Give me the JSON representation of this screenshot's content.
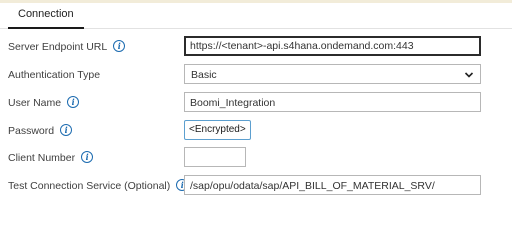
{
  "tabs": {
    "active": "Connection"
  },
  "form": {
    "server_endpoint": {
      "label": "Server Endpoint URL",
      "value": "https://<tenant>-api.s4hana.ondemand.com:443"
    },
    "authentication_type": {
      "label": "Authentication Type",
      "value": "Basic"
    },
    "user_name": {
      "label": "User Name",
      "value": "Boomi_Integration"
    },
    "password": {
      "label": "Password",
      "button": "<Encrypted>"
    },
    "client_number": {
      "label": "Client Number",
      "value": ""
    },
    "test_service": {
      "label": "Test Connection Service (Optional)",
      "value": "/sap/opu/odata/sap/API_BILL_OF_MATERIAL_SRV/"
    }
  },
  "icons": {
    "info": "info-icon",
    "dropdown": "chevron-down-icon"
  },
  "colors": {
    "info_blue": "#1c6bb0",
    "button_border": "#5c9fcf",
    "focus_border": "#2b2b2b"
  }
}
